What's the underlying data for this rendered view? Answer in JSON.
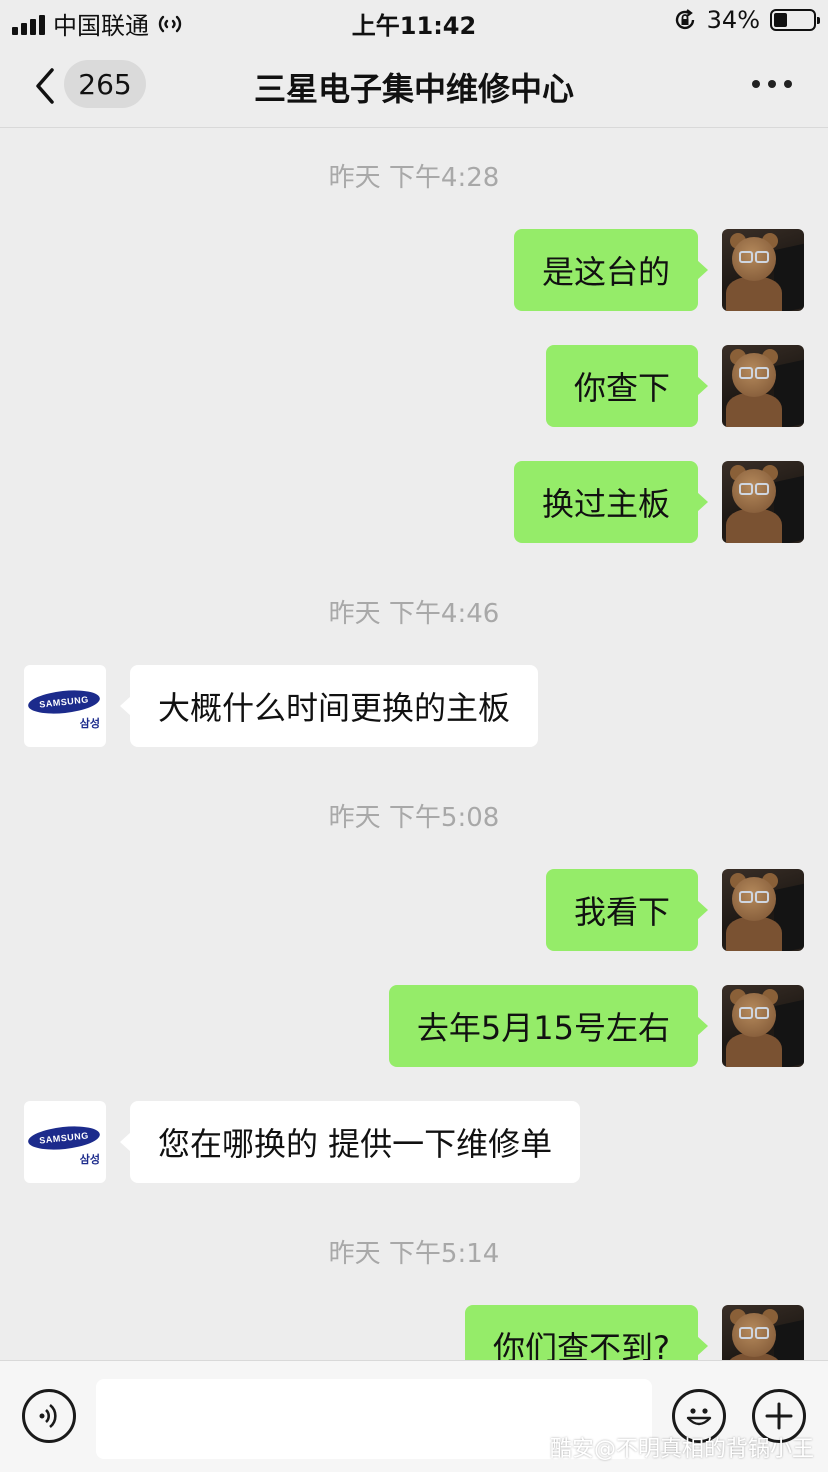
{
  "status_bar": {
    "carrier": "中国联通",
    "time": "上午11:42",
    "battery": "34%",
    "battery_level": 0.34,
    "icons": [
      "signal-icon",
      "hotspot-icon",
      "rotation-lock-icon",
      "battery-icon"
    ]
  },
  "nav": {
    "unread_count": "265",
    "title": "三星电子集中维修中心",
    "icons": [
      "back-chevron-icon",
      "more-icon"
    ]
  },
  "messages": [
    {
      "type": "timestamp",
      "text": "昨天 下午4:28"
    },
    {
      "type": "me",
      "text": "是这台的"
    },
    {
      "type": "me",
      "text": "你查下"
    },
    {
      "type": "me",
      "text": "换过主板"
    },
    {
      "type": "timestamp",
      "text": "昨天 下午4:46"
    },
    {
      "type": "them",
      "text": "大概什么时间更换的主板"
    },
    {
      "type": "timestamp",
      "text": "昨天 下午5:08"
    },
    {
      "type": "me",
      "text": "我看下"
    },
    {
      "type": "me",
      "text": "去年5月15号左右"
    },
    {
      "type": "them",
      "text": "您在哪换的 提供一下维修单"
    },
    {
      "type": "timestamp",
      "text": "昨天 下午5:14"
    },
    {
      "type": "me",
      "text": "你们查不到?"
    }
  ],
  "contact_avatar": {
    "logo": "SAMSUNG",
    "korean": "삼성"
  },
  "bottom_bar": {
    "icons": [
      "voice-icon",
      "emoji-icon",
      "plus-icon"
    ],
    "input_value": ""
  },
  "watermark": "酷安@不明真相的背锅小王"
}
